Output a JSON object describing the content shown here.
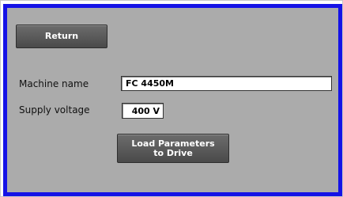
{
  "buttons": {
    "return_label": "Return",
    "load_label": "Load Parameters\nto Drive"
  },
  "fields": {
    "machine_name": {
      "label": "Machine name",
      "value": "FC 4450M"
    },
    "supply_voltage": {
      "label": "Supply voltage",
      "value": "400 V"
    }
  },
  "colors": {
    "panel_background": "#ababab",
    "panel_border": "#1512e6",
    "button_background": "#5a5a5a",
    "field_background": "#ffffff"
  }
}
